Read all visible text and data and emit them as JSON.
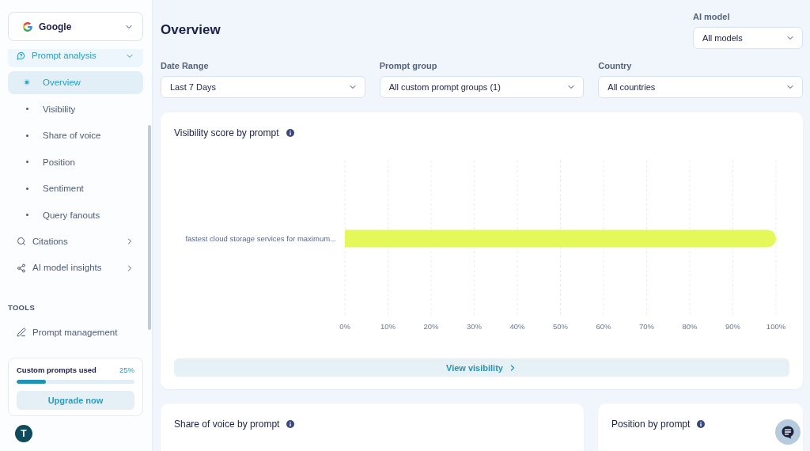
{
  "sidebar": {
    "workspace_select": {
      "value": "Google"
    },
    "nav": [
      {
        "label": "Prompt analysis",
        "expanded": true,
        "children": [
          {
            "label": "Overview",
            "selected": true
          },
          {
            "label": "Visibility",
            "selected": false
          },
          {
            "label": "Share of voice",
            "selected": false
          },
          {
            "label": "Position",
            "selected": false
          },
          {
            "label": "Sentiment",
            "selected": false
          },
          {
            "label": "Query fanouts",
            "selected": false
          }
        ]
      },
      {
        "label": "Citations",
        "expanded": false
      },
      {
        "label": "AI model insights",
        "expanded": false
      }
    ],
    "tools": {
      "heading": "TOOLS",
      "items": [
        {
          "label": "Prompt management"
        }
      ]
    },
    "usage": {
      "title": "Custom prompts used",
      "reading": "25%",
      "level": 0.25,
      "button": "Upgrade now"
    },
    "user": {
      "initial": "T"
    }
  },
  "header": {
    "title": "Overview",
    "ai_model": {
      "label": "AI model",
      "value": "All models"
    }
  },
  "filters": [
    {
      "label": "Date Range",
      "value": "Last 7 Days"
    },
    {
      "label": "Prompt group",
      "value": "All custom prompt groups (1)"
    },
    {
      "label": "Country",
      "value": "All countries"
    }
  ],
  "visibility_card": {
    "title": "Visibility score by prompt",
    "chart_data": {
      "type": "bar",
      "orientation": "horizontal",
      "grid": true,
      "categories": [
        "fastest cloud storage services for maximum..."
      ],
      "values": [
        100
      ],
      "xlim": [
        0,
        100
      ],
      "xticks": [
        {
          "value": 0,
          "label": "0%"
        },
        {
          "value": 10,
          "label": "10%"
        },
        {
          "value": 20,
          "label": "20%"
        },
        {
          "value": 30,
          "label": "30%"
        },
        {
          "value": 40,
          "label": "40%"
        },
        {
          "value": 50,
          "label": "50%"
        },
        {
          "value": 60,
          "label": "60%"
        },
        {
          "value": 70,
          "label": "70%"
        },
        {
          "value": 80,
          "label": "80%"
        },
        {
          "value": 90,
          "label": "90%"
        },
        {
          "value": 100,
          "label": "100%"
        }
      ]
    },
    "link": "View visibility"
  },
  "bottom_cards": [
    {
      "title": "Share of voice by prompt"
    },
    {
      "title": "Position by prompt"
    }
  ]
}
